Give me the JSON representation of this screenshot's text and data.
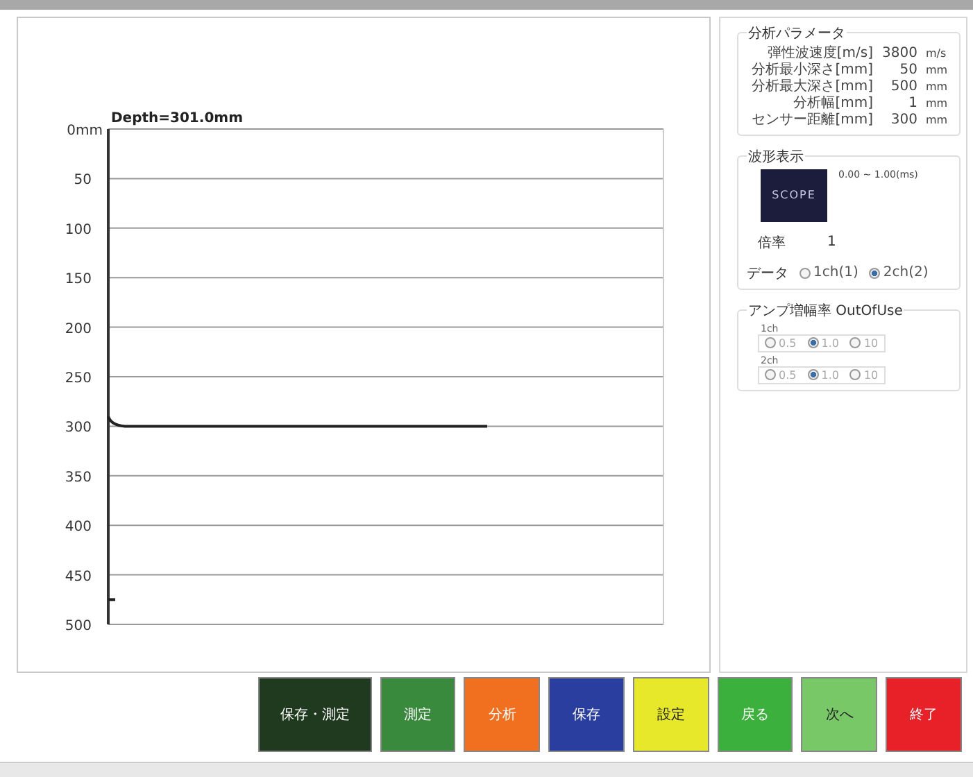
{
  "chart": {
    "title": "Depth=301.0mm",
    "y_labels": [
      "0mm",
      "50",
      "100",
      "150",
      "200",
      "250",
      "300",
      "350",
      "400",
      "450",
      "500"
    ]
  },
  "parameters": {
    "title": "分析パラメータ",
    "rows": [
      {
        "label": "弾性波速度[m/s]",
        "value": "3800",
        "unit": "m/s"
      },
      {
        "label": "分析最小深さ[mm]",
        "value": "50",
        "unit": "mm"
      },
      {
        "label": "分析最大深さ[mm]",
        "value": "500",
        "unit": "mm"
      },
      {
        "label": "分析幅[mm]",
        "value": "1",
        "unit": "mm"
      },
      {
        "label": "センサー距離[mm]",
        "value": "300",
        "unit": "mm"
      }
    ]
  },
  "waveform": {
    "title": "波形表示",
    "scope": "SCOPE",
    "range": "0.00 ~ 1.00(ms)",
    "gain_label": "倍率",
    "gain": "1",
    "data_label": "データ",
    "data_options": [
      {
        "label": "1ch(1)",
        "selected": false
      },
      {
        "label": "2ch(2)",
        "selected": true
      }
    ]
  },
  "amp": {
    "title": "アンプ増幅率 OutOfUse",
    "channels": [
      {
        "label": "1ch",
        "options": [
          {
            "label": "0.5",
            "selected": false
          },
          {
            "label": "1.0",
            "selected": true
          },
          {
            "label": "10",
            "selected": false
          }
        ]
      },
      {
        "label": "2ch",
        "options": [
          {
            "label": "0.5",
            "selected": false
          },
          {
            "label": "1.0",
            "selected": true
          },
          {
            "label": "10",
            "selected": false
          }
        ]
      }
    ]
  },
  "buttons": [
    {
      "label": "保存・測定",
      "color": "#1f3a1f"
    },
    {
      "label": "測定",
      "color": "#3a8a3e"
    },
    {
      "label": "分析",
      "color": "#f07020"
    },
    {
      "label": "保存",
      "color": "#2a3ea0"
    },
    {
      "label": "設定",
      "color": "#e8e82a"
    },
    {
      "label": "戻る",
      "color": "#3cb03c"
    },
    {
      "label": "次へ",
      "color": "#78c868"
    },
    {
      "label": "終了",
      "color": "#e82028"
    }
  ]
}
